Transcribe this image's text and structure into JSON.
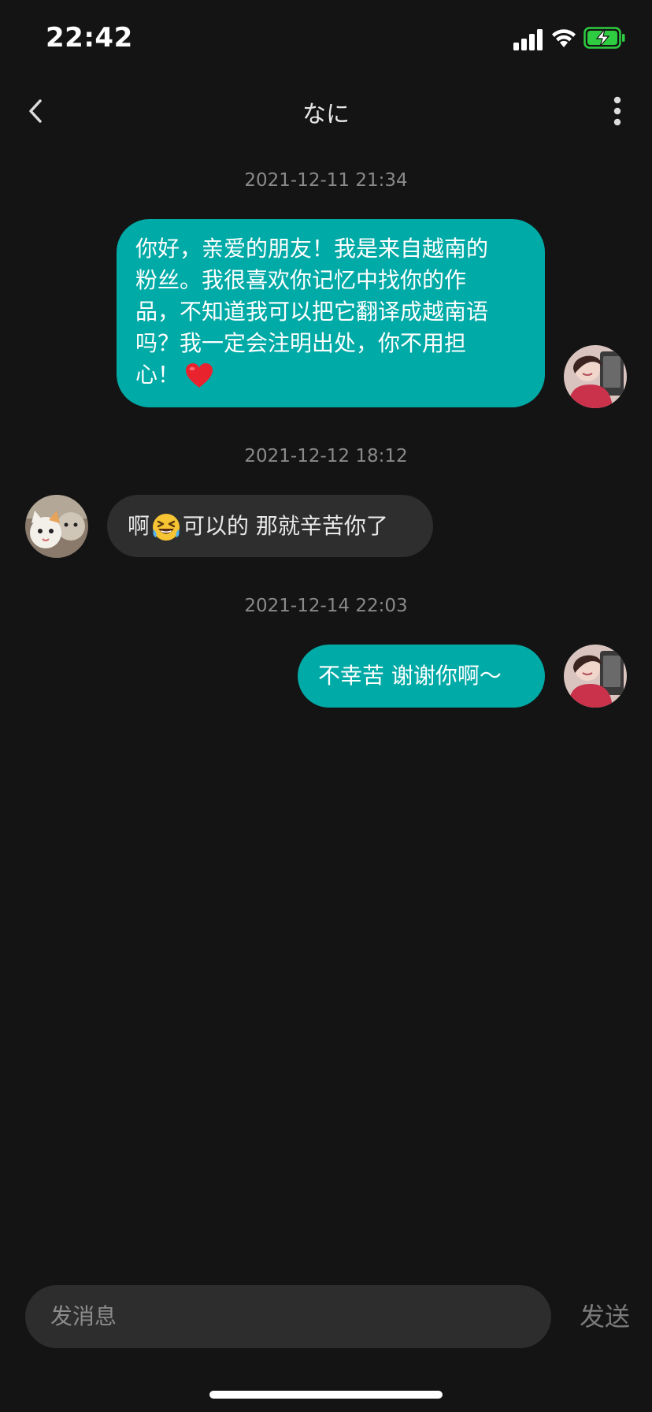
{
  "status_bar": {
    "time": "22:42",
    "icons": [
      "signal-icon",
      "wifi-icon",
      "battery-charging-icon"
    ],
    "battery_color": "#2ecc40"
  },
  "nav": {
    "title": "なに",
    "back_icon": "chevron-left-icon",
    "more_icon": "more-vertical-icon"
  },
  "messages": [
    {
      "timestamp": "2021-12-11 21:34",
      "direction": "sent",
      "lines": [
        "你好，亲爱的朋友！我是来自越南的",
        "粉丝。我很喜欢你记忆中找你的作",
        "品，不知道我可以把它翻译成越南语",
        "吗？我一定会注明出处，你不用担",
        "心！"
      ],
      "trailing_emoji": "red-heart-emoji"
    },
    {
      "timestamp": "2021-12-12 18:12",
      "direction": "received",
      "text_before": "啊",
      "emoji": "rolling-laughing-emoji",
      "text_after": "可以的 那就辛苦你了"
    },
    {
      "timestamp": "2021-12-14 22:03",
      "direction": "sent",
      "text": "不幸苦 谢谢你啊～"
    }
  ],
  "input": {
    "placeholder": "发消息",
    "send_label": "发送"
  },
  "colors": {
    "background": "#141414",
    "sent_bubble": "#00aaa6",
    "received_bubble": "#2e2e2e",
    "input_bg": "#2d2d2d"
  }
}
